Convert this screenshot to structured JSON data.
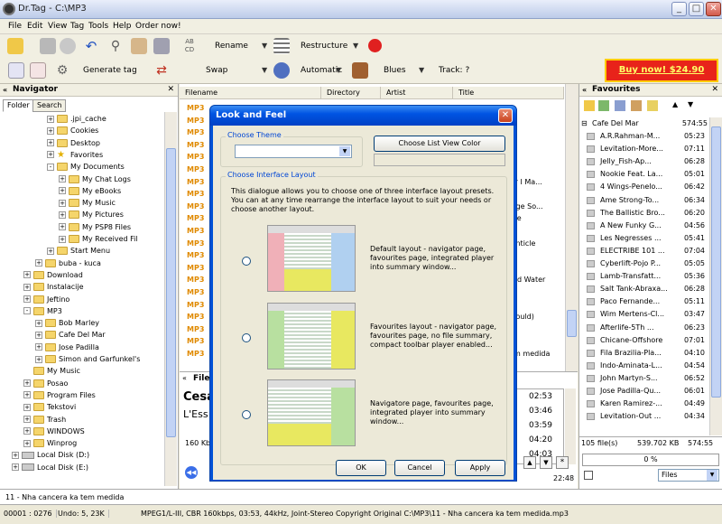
{
  "window": {
    "title": "Dr.Tag - C:\\MP3"
  },
  "menu": [
    "File",
    "Edit",
    "View",
    "Tag",
    "Tools",
    "Help",
    "Order now!"
  ],
  "toolbar": {
    "rename": "Rename",
    "restructure": "Restructure",
    "generate_tag": "Generate tag",
    "swap": "Swap",
    "automatic": "Automatic",
    "genre": "Blues",
    "track": "Track: ?",
    "buy_now": "Buy now! $24.90"
  },
  "navigator": {
    "title": "Navigator",
    "tabs": [
      "Folder",
      "Search"
    ],
    "tree": [
      {
        "label": ".jpi_cache",
        "level": 4,
        "type": "folder",
        "pm": "+"
      },
      {
        "label": "Cookies",
        "level": 4,
        "type": "folder",
        "pm": "+"
      },
      {
        "label": "Desktop",
        "level": 4,
        "type": "folder",
        "pm": "+"
      },
      {
        "label": "Favorites",
        "level": 4,
        "type": "star",
        "pm": "+"
      },
      {
        "label": "My Documents",
        "level": 4,
        "type": "folder",
        "pm": "-"
      },
      {
        "label": "My Chat Logs",
        "level": 5,
        "type": "folder",
        "pm": "+"
      },
      {
        "label": "My eBooks",
        "level": 5,
        "type": "folder",
        "pm": "+"
      },
      {
        "label": "My Music",
        "level": 5,
        "type": "folder",
        "pm": "+"
      },
      {
        "label": "My Pictures",
        "level": 5,
        "type": "folder",
        "pm": "+"
      },
      {
        "label": "My PSP8 Files",
        "level": 5,
        "type": "folder",
        "pm": "+"
      },
      {
        "label": "My Received Fil",
        "level": 5,
        "type": "folder",
        "pm": "+"
      },
      {
        "label": "Start Menu",
        "level": 4,
        "type": "folder",
        "pm": "+"
      },
      {
        "label": "buba - kuca",
        "level": 3,
        "type": "folder",
        "pm": "+"
      },
      {
        "label": "Download",
        "level": 2,
        "type": "folder",
        "pm": "+"
      },
      {
        "label": "Instalacije",
        "level": 2,
        "type": "folder",
        "pm": "+"
      },
      {
        "label": "Jeftino",
        "level": 2,
        "type": "folder",
        "pm": "+"
      },
      {
        "label": "MP3",
        "level": 2,
        "type": "folder",
        "pm": "-"
      },
      {
        "label": "Bob Marley",
        "level": 3,
        "type": "folder",
        "pm": "+"
      },
      {
        "label": "Cafe Del Mar",
        "level": 3,
        "type": "folder",
        "pm": "+"
      },
      {
        "label": "Jose Padilla",
        "level": 3,
        "type": "folder",
        "pm": "+"
      },
      {
        "label": "Simon and Garfunkel's",
        "level": 3,
        "type": "folder",
        "pm": "+"
      },
      {
        "label": "My Music",
        "level": 2,
        "type": "folder",
        "pm": ""
      },
      {
        "label": "Posao",
        "level": 2,
        "type": "folder",
        "pm": "+"
      },
      {
        "label": "Program Files",
        "level": 2,
        "type": "folder",
        "pm": "+"
      },
      {
        "label": "Tekstovi",
        "level": 2,
        "type": "folder",
        "pm": "+"
      },
      {
        "label": "Trash",
        "level": 2,
        "type": "folder",
        "pm": "+"
      },
      {
        "label": "WINDOWS",
        "level": 2,
        "type": "folder",
        "pm": "+"
      },
      {
        "label": "Winprog",
        "level": 2,
        "type": "folder",
        "pm": "+"
      },
      {
        "label": "Local Disk (D:)",
        "level": 1,
        "type": "drive",
        "pm": "+"
      },
      {
        "label": "Local Disk (E:)",
        "level": 1,
        "type": "drive",
        "pm": "+"
      }
    ]
  },
  "filelist": {
    "columns": [
      "Filename",
      "Directory",
      "Artist",
      "Title"
    ],
    "row_icon": "MP3",
    "titles": [
      "",
      "",
      "",
      "",
      "",
      "",
      "ver I Ma...",
      "",
      "ridge So...",
      "ince",
      "",
      "Canticle",
      "",
      "",
      "oled Water",
      "",
      "",
      "I Could)",
      "",
      "",
      "tem medida"
    ]
  },
  "info": {
    "label": "File",
    "artist_partial": "Cesa",
    "album_partial": "L'Ess",
    "bitrate_partial": "160 Kbp",
    "times": [
      "02:53",
      "03:46",
      "03:59",
      "04:20",
      "04:03"
    ],
    "total": "22:48"
  },
  "favourites": {
    "title": "Favourites",
    "group": "Cafe Del Mar",
    "group_time": "574:55",
    "items": [
      {
        "name": "A.R.Rahman-M...",
        "time": "05:23"
      },
      {
        "name": "Levitation-More...",
        "time": "07:11"
      },
      {
        "name": "Jelly_Fish-Ap...",
        "time": "06:28"
      },
      {
        "name": "Nookie Feat. La...",
        "time": "05:01"
      },
      {
        "name": "4 Wings-Penelo...",
        "time": "06:42"
      },
      {
        "name": "Ame Strong-To...",
        "time": "06:34"
      },
      {
        "name": "The Ballistic Bro...",
        "time": "06:20"
      },
      {
        "name": "A New Funky G...",
        "time": "04:56"
      },
      {
        "name": "Les Negresses ...",
        "time": "05:41"
      },
      {
        "name": "ELECTRIBE 101 ...",
        "time": "07:04"
      },
      {
        "name": "Cyberlift-Pojo P...",
        "time": "05:05"
      },
      {
        "name": "Lamb-Transfatt...",
        "time": "05:36"
      },
      {
        "name": "Salt Tank-Abraxa...",
        "time": "06:28"
      },
      {
        "name": "Paco Fernande...",
        "time": "05:11"
      },
      {
        "name": "Wim Mertens-Cl...",
        "time": "03:47"
      },
      {
        "name": "Afterlife-5Th ...",
        "time": "06:23"
      },
      {
        "name": "Chicane-Offshore",
        "time": "07:01"
      },
      {
        "name": "Fila Brazilia-Pla...",
        "time": "04:10"
      },
      {
        "name": "Indo-Aminata-L...",
        "time": "04:54"
      },
      {
        "name": "John Martyn-S...",
        "time": "06:52"
      },
      {
        "name": "Jose Padilla-Qu...",
        "time": "06:01"
      },
      {
        "name": "Karen Ramirez-...",
        "time": "04:49"
      },
      {
        "name": "Levitation-Out ...",
        "time": "04:34"
      }
    ],
    "file_count": "105 file(s)",
    "size": "539.702 KB",
    "total": "574:55",
    "progress": "0 %",
    "filter": "Files"
  },
  "current_file": "11 - Nha cancera ka tem medida",
  "status": {
    "pos": "00001 : 0276",
    "undo": "Undo: 5, 23K",
    "info": "MPEG1/L-III, CBR 160kbps, 03:53, 44kHz,  Joint-Stereo  Copyright  Original  C:\\MP3\\11 - Nha cancera ka tem medida.mp3"
  },
  "dialog": {
    "title": "Look and Feel",
    "choose_theme": "Choose Theme",
    "list_color_btn": "Choose List View Color",
    "choose_layout": "Choose Interface Layout",
    "intro": "This dialogue allows you to choose one of three interface layout presets. You can at any time rearrange the interface layout to suit your needs or choose another layout.",
    "layouts": [
      "Default layout - navigator page, favourites page, integrated player into summary window...",
      "Favourites layout - navigator page, favourites page, no file summary, compact toolbar player enabled...",
      "Navigatore page, favourites page, integrated player into summary window..."
    ],
    "ok": "OK",
    "cancel": "Cancel",
    "apply": "Apply"
  },
  "colors": {
    "accent": "#0054e3",
    "buy": "#e8231a",
    "mp3": "#e08a00"
  }
}
